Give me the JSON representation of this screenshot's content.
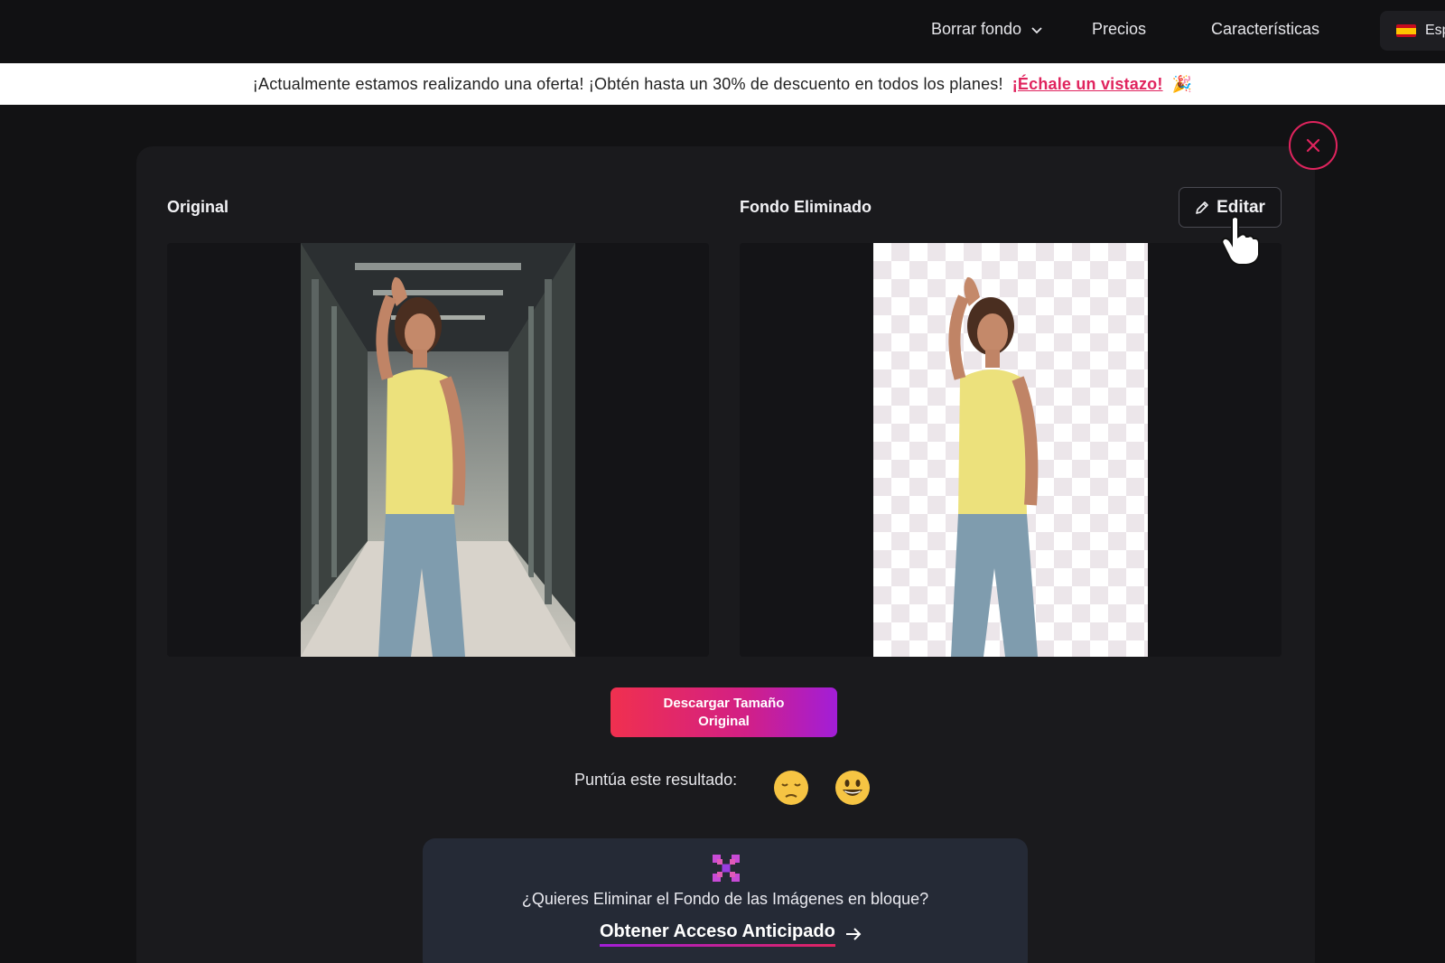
{
  "nav": {
    "items": [
      {
        "label": "Borrar fondo",
        "has_dropdown": true
      },
      {
        "label": "Precios"
      },
      {
        "label": "Características"
      }
    ],
    "language": {
      "label": "Esp",
      "flag": "spain-flag"
    }
  },
  "promo": {
    "text": "¡Actualmente estamos realizando una oferta! ¡Obtén hasta un 30% de descuento en todos los planes!",
    "cta": "¡Échale un vistazo!",
    "emoji": "🎉"
  },
  "result": {
    "original_label": "Original",
    "removed_label": "Fondo Eliminado",
    "edit_label": "Editar",
    "download_label": "Descargar Tamaño Original",
    "rate_label": "Puntúa este resultado:",
    "rate_options": [
      "😔",
      "😀"
    ]
  },
  "bulk": {
    "question": "¿Quieres Eliminar el Fondo de las Imágenes en bloque?",
    "cta": "Obtener Acceso Anticipado"
  },
  "colors": {
    "accent": "#e0245e",
    "gradient_start": "#f0304f",
    "gradient_end": "#a21ed8",
    "background": "#121214"
  }
}
